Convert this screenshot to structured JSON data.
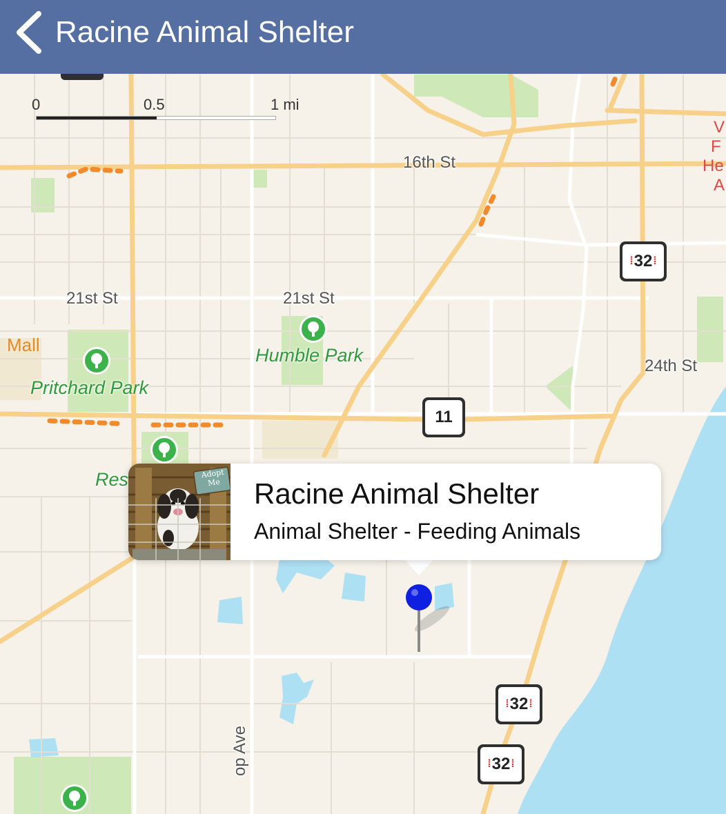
{
  "navbar": {
    "title": "Racine Animal Shelter",
    "back_icon": "chevron-left-icon",
    "background": "#566fa2"
  },
  "scale": {
    "tick_0": "0",
    "tick_half": "0.5",
    "tick_1": "1 mi"
  },
  "streets": {
    "s16th": "16th St",
    "s21st_west": "21st St",
    "s21st_center": "21st St",
    "s24th": "24th St",
    "ave_partial": "op Ave"
  },
  "parks": {
    "pritchard": "Pritchard Park",
    "humble": "Humble Park",
    "res_partial": "Res"
  },
  "pois": {
    "mall": "Mall",
    "red_partial_1": "V",
    "red_partial_2": "F",
    "red_partial_3": "He",
    "red_partial_4": "A"
  },
  "shields": {
    "us32_top": "32",
    "state11": "11",
    "us32_mid": "32",
    "us32_bottom": "32"
  },
  "callout": {
    "title": "Racine Animal Shelter",
    "subtitle": "Animal Shelter - Feeding Animals",
    "image_sign": "Adopt Me"
  },
  "colors": {
    "map_background": "#f6f2ea",
    "park_green": "#cfe8b8",
    "water": "#aee0f4",
    "major_road": "#f7d18a",
    "pin_blue": "#1020e0"
  }
}
